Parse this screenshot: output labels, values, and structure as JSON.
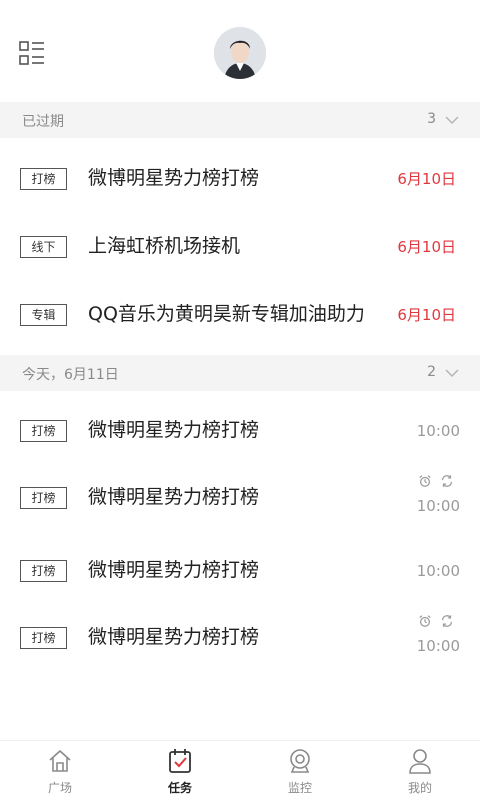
{
  "colors": {
    "accent": "#e0383e",
    "section_bg": "#f4f4f4",
    "muted_text": "#8a8a8a"
  },
  "sections": [
    {
      "title": "已过期",
      "count": "3",
      "tasks": [
        {
          "tag": "打榜",
          "title": "微博明星势力榜打榜",
          "date": "6月10日"
        },
        {
          "tag": "线下",
          "title": "上海虹桥机场接机",
          "date": "6月10日"
        },
        {
          "tag": "专辑",
          "title": "QQ音乐为黄明昊新专辑加油助力",
          "date": "6月10日"
        }
      ]
    },
    {
      "title": "今天，6月11日",
      "count": "2",
      "tasks": [
        {
          "tag": "打榜",
          "title": "微博明星势力榜打榜",
          "time": "10:00"
        },
        {
          "tag": "打榜",
          "title": "微博明星势力榜打榜",
          "time": "10:00",
          "icons": [
            "alarm-icon",
            "repeat-icon"
          ]
        },
        {
          "tag": "打榜",
          "title": "微博明星势力榜打榜",
          "time": "10:00"
        },
        {
          "tag": "打榜",
          "title": "微博明星势力榜打榜",
          "time": "10:00",
          "icons": [
            "alarm-icon",
            "repeat-icon"
          ]
        }
      ]
    }
  ],
  "nav": [
    {
      "label": "广场",
      "icon": "home-icon",
      "active": false
    },
    {
      "label": "任务",
      "icon": "task-icon",
      "active": true
    },
    {
      "label": "监控",
      "icon": "camera-icon",
      "active": false
    },
    {
      "label": "我的",
      "icon": "profile-icon",
      "active": false
    }
  ]
}
